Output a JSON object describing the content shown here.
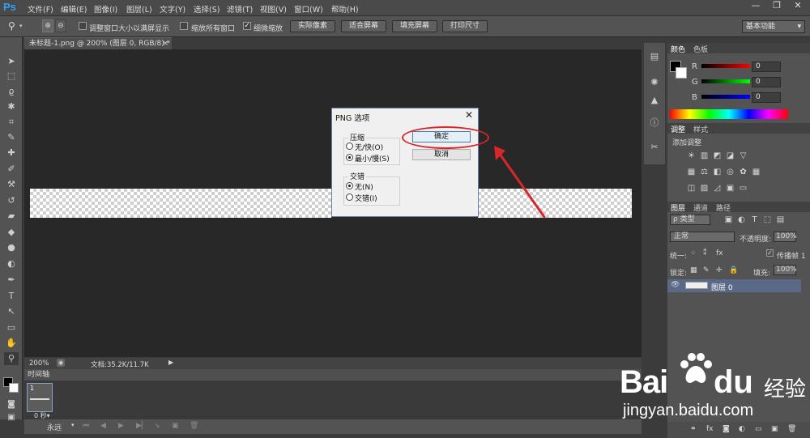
{
  "app": {
    "logo": "Ps"
  },
  "menu": [
    "文件(F)",
    "编辑(E)",
    "图像(I)",
    "图层(L)",
    "文字(Y)",
    "选择(S)",
    "滤镜(T)",
    "视图(V)",
    "窗口(W)",
    "帮助(H)"
  ],
  "window_controls": {
    "minimize": "—",
    "restore": "❐",
    "close": "✕"
  },
  "options_bar": {
    "resize_windows_label": "调整窗口大小以满屏显示",
    "resize_windows_checked": false,
    "zoom_all_label": "缩放所有窗口",
    "zoom_all_checked": false,
    "scrubby_zoom_label": "细微缩放",
    "scrubby_zoom_checked": true,
    "actual_pixels": "实际像素",
    "fit_screen": "适合屏幕",
    "fill_screen": "填充屏幕",
    "print_size": "打印尺寸",
    "workspace": "基本功能"
  },
  "document": {
    "tab_title": "未标题-1.png @ 200% (图层 0, RGB/8) *",
    "tab_close": "×",
    "zoom": "200%",
    "doc_info": "文档:35.2K/11.7K"
  },
  "timeline": {
    "title": "时间轴",
    "frame_number": "1",
    "frame_delay": "0 秒▾",
    "loop": "永远"
  },
  "color_panel": {
    "tabs": [
      "颜色",
      "色板"
    ],
    "channels": [
      {
        "label": "R",
        "value": "0"
      },
      {
        "label": "G",
        "value": "0"
      },
      {
        "label": "B",
        "value": "0"
      }
    ]
  },
  "adjustments_panel": {
    "tabs": [
      "调整",
      "样式"
    ],
    "heading": "添加调整"
  },
  "layers_panel": {
    "tabs": [
      "图层",
      "通道",
      "路径"
    ],
    "filter_kind": "ρ 类型",
    "blend_mode": "正常",
    "opacity_label": "不透明度:",
    "opacity_value": "100%",
    "unify_label": "统一:",
    "propagate_label": "传播帧 1",
    "lock_label": "锁定:",
    "fill_label": "填充:",
    "fill_value": "100%",
    "layer_name": "图层 0"
  },
  "dialog": {
    "title": "PNG 选项",
    "close": "✕",
    "compression_label": "压缩",
    "compression_options": [
      "无/快(O)",
      "最小/慢(S)"
    ],
    "compression_selected": 1,
    "interlace_label": "交错",
    "interlace_options": [
      "无(N)",
      "交错(I)"
    ],
    "interlace_selected": 0,
    "ok": "确定",
    "cancel": "取消"
  },
  "watermark": {
    "brand": "Bai",
    "brand_tail": "du",
    "product": "经验",
    "url": "jingyan.baidu.com"
  },
  "colors": {
    "accent_annotation": "#d9262a",
    "ps_blue": "#2fa3f5",
    "canvas_bg": "#282828"
  }
}
